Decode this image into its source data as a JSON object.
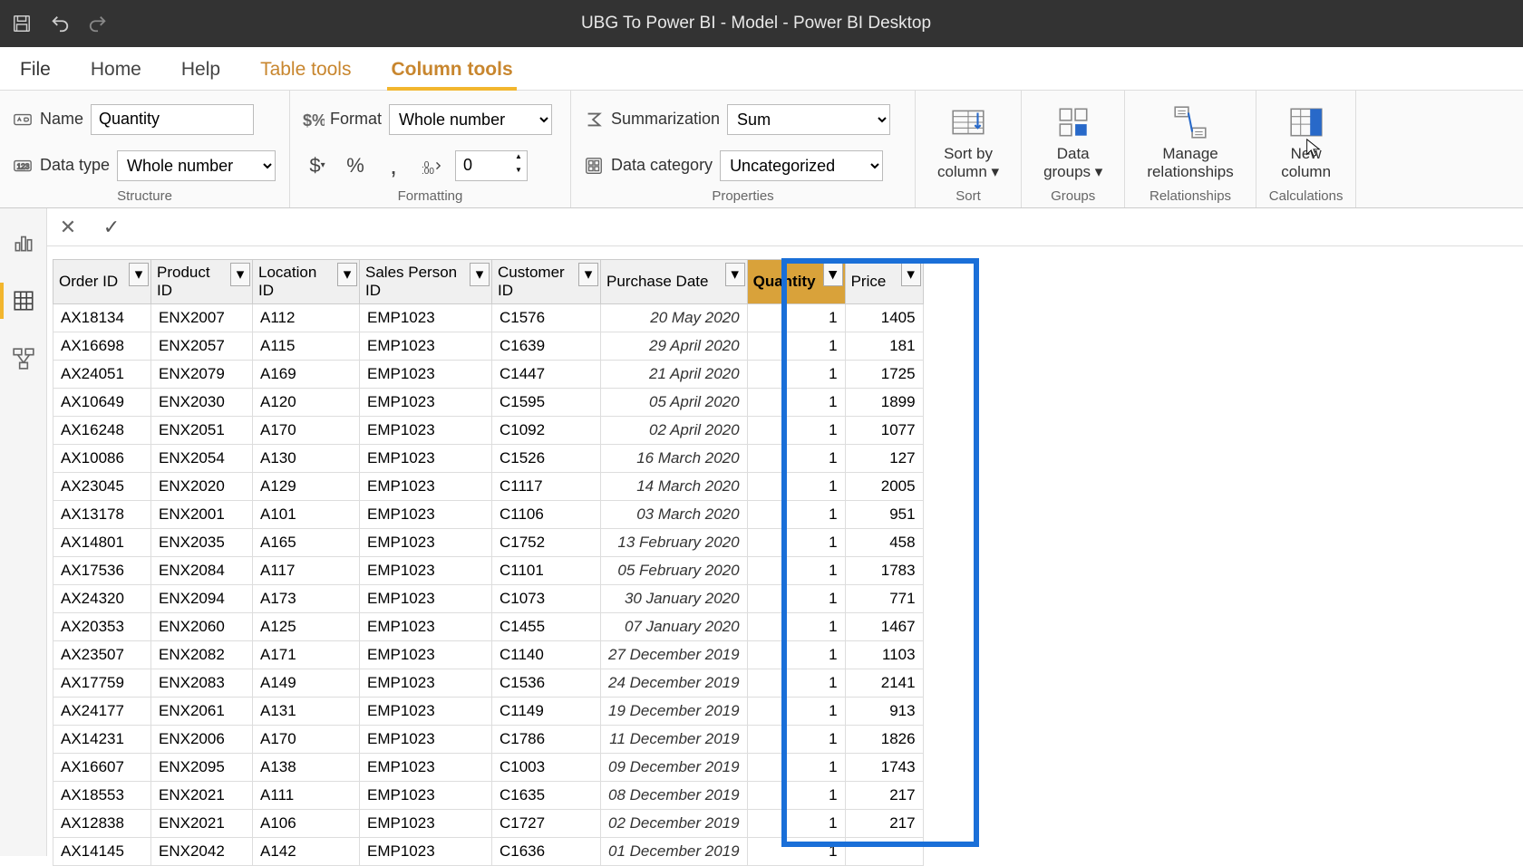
{
  "titlebar": {
    "title": "UBG To Power BI - Model - Power BI Desktop"
  },
  "tabs": {
    "file": "File",
    "home": "Home",
    "help": "Help",
    "tabletools": "Table tools",
    "columntools": "Column tools"
  },
  "ribbon": {
    "structure": {
      "label": "Structure",
      "name_label": "Name",
      "name_value": "Quantity",
      "datatype_label": "Data type",
      "datatype_value": "Whole number"
    },
    "formatting": {
      "label": "Formatting",
      "format_label": "Format",
      "format_value": "Whole number",
      "decimals_value": "0"
    },
    "properties": {
      "label": "Properties",
      "summarization_label": "Summarization",
      "summarization_value": "Sum",
      "datacategory_label": "Data category",
      "datacategory_value": "Uncategorized"
    },
    "sort": {
      "label": "Sort",
      "button": "Sort by\ncolumn"
    },
    "groups": {
      "label": "Groups",
      "button": "Data\ngroups"
    },
    "relationships": {
      "label": "Relationships",
      "button": "Manage\nrelationships"
    },
    "calculations": {
      "label": "Calculations",
      "button": "New\ncolumn"
    }
  },
  "columns": {
    "order_id": "Order ID",
    "product_id": "Product ID",
    "location_id": "Location ID",
    "sales_person_id": "Sales Person ID",
    "customer_id": "Customer ID",
    "purchase_date": "Purchase Date",
    "quantity": "Quantity",
    "price": "Price"
  },
  "rows": [
    {
      "order": "AX18134",
      "prod": "ENX2007",
      "loc": "A112",
      "sp": "EMP1023",
      "cust": "C1576",
      "date": "20 May 2020",
      "qty": "1",
      "price": "1405"
    },
    {
      "order": "AX16698",
      "prod": "ENX2057",
      "loc": "A115",
      "sp": "EMP1023",
      "cust": "C1639",
      "date": "29 April 2020",
      "qty": "1",
      "price": "181"
    },
    {
      "order": "AX24051",
      "prod": "ENX2079",
      "loc": "A169",
      "sp": "EMP1023",
      "cust": "C1447",
      "date": "21 April 2020",
      "qty": "1",
      "price": "1725"
    },
    {
      "order": "AX10649",
      "prod": "ENX2030",
      "loc": "A120",
      "sp": "EMP1023",
      "cust": "C1595",
      "date": "05 April 2020",
      "qty": "1",
      "price": "1899"
    },
    {
      "order": "AX16248",
      "prod": "ENX2051",
      "loc": "A170",
      "sp": "EMP1023",
      "cust": "C1092",
      "date": "02 April 2020",
      "qty": "1",
      "price": "1077"
    },
    {
      "order": "AX10086",
      "prod": "ENX2054",
      "loc": "A130",
      "sp": "EMP1023",
      "cust": "C1526",
      "date": "16 March 2020",
      "qty": "1",
      "price": "127"
    },
    {
      "order": "AX23045",
      "prod": "ENX2020",
      "loc": "A129",
      "sp": "EMP1023",
      "cust": "C1117",
      "date": "14 March 2020",
      "qty": "1",
      "price": "2005"
    },
    {
      "order": "AX13178",
      "prod": "ENX2001",
      "loc": "A101",
      "sp": "EMP1023",
      "cust": "C1106",
      "date": "03 March 2020",
      "qty": "1",
      "price": "951"
    },
    {
      "order": "AX14801",
      "prod": "ENX2035",
      "loc": "A165",
      "sp": "EMP1023",
      "cust": "C1752",
      "date": "13 February 2020",
      "qty": "1",
      "price": "458"
    },
    {
      "order": "AX17536",
      "prod": "ENX2084",
      "loc": "A117",
      "sp": "EMP1023",
      "cust": "C1101",
      "date": "05 February 2020",
      "qty": "1",
      "price": "1783"
    },
    {
      "order": "AX24320",
      "prod": "ENX2094",
      "loc": "A173",
      "sp": "EMP1023",
      "cust": "C1073",
      "date": "30 January 2020",
      "qty": "1",
      "price": "771"
    },
    {
      "order": "AX20353",
      "prod": "ENX2060",
      "loc": "A125",
      "sp": "EMP1023",
      "cust": "C1455",
      "date": "07 January 2020",
      "qty": "1",
      "price": "1467"
    },
    {
      "order": "AX23507",
      "prod": "ENX2082",
      "loc": "A171",
      "sp": "EMP1023",
      "cust": "C1140",
      "date": "27 December 2019",
      "qty": "1",
      "price": "1103"
    },
    {
      "order": "AX17759",
      "prod": "ENX2083",
      "loc": "A149",
      "sp": "EMP1023",
      "cust": "C1536",
      "date": "24 December 2019",
      "qty": "1",
      "price": "2141"
    },
    {
      "order": "AX24177",
      "prod": "ENX2061",
      "loc": "A131",
      "sp": "EMP1023",
      "cust": "C1149",
      "date": "19 December 2019",
      "qty": "1",
      "price": "913"
    },
    {
      "order": "AX14231",
      "prod": "ENX2006",
      "loc": "A170",
      "sp": "EMP1023",
      "cust": "C1786",
      "date": "11 December 2019",
      "qty": "1",
      "price": "1826"
    },
    {
      "order": "AX16607",
      "prod": "ENX2095",
      "loc": "A138",
      "sp": "EMP1023",
      "cust": "C1003",
      "date": "09 December 2019",
      "qty": "1",
      "price": "1743"
    },
    {
      "order": "AX18553",
      "prod": "ENX2021",
      "loc": "A111",
      "sp": "EMP1023",
      "cust": "C1635",
      "date": "08 December 2019",
      "qty": "1",
      "price": "217"
    },
    {
      "order": "AX12838",
      "prod": "ENX2021",
      "loc": "A106",
      "sp": "EMP1023",
      "cust": "C1727",
      "date": "02 December 2019",
      "qty": "1",
      "price": "217"
    },
    {
      "order": "AX14145",
      "prod": "ENX2042",
      "loc": "A142",
      "sp": "EMP1023",
      "cust": "C1636",
      "date": "01 December 2019",
      "qty": "1",
      "price": ""
    }
  ]
}
